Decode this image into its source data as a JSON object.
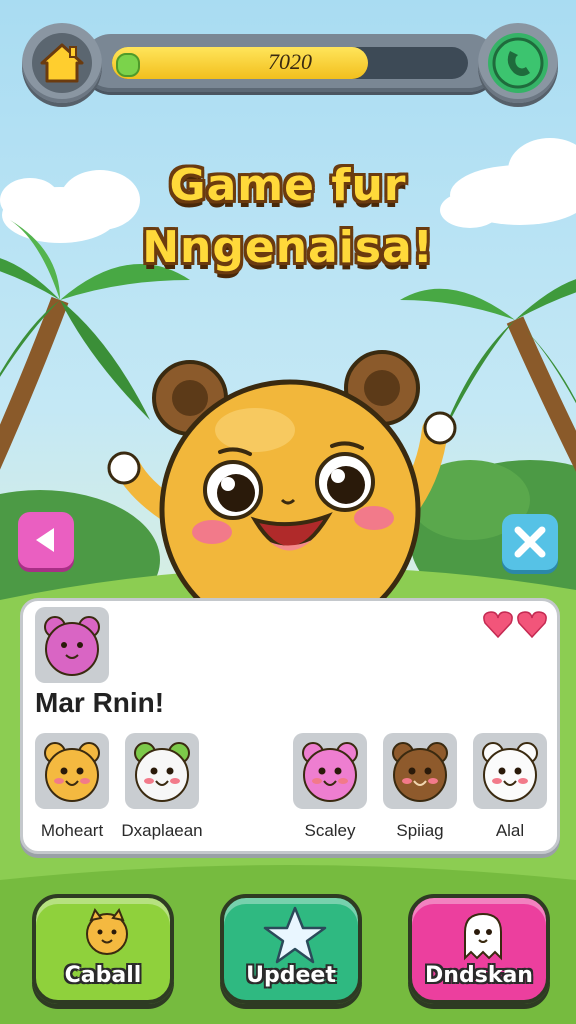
{
  "top_bar": {
    "score": "7020",
    "progress": 0.72,
    "home_icon": "home-icon",
    "phone_icon": "phone-icon"
  },
  "title": {
    "line1": "Game fur",
    "line2": "Nngenaisa!"
  },
  "side_buttons": {
    "left_icon": "back-arrow-icon",
    "right_icon": "close-x-icon"
  },
  "panel": {
    "heading": "Mar Rnin!",
    "lives": 2,
    "characters": [
      {
        "label": "Moheart",
        "color": "#f4b940",
        "icon": "yellow-bear-icon"
      },
      {
        "label": "Dxaplaean",
        "color": "#f7f7f7",
        "icon": "white-sheep-icon"
      },
      {
        "label": "Scaley",
        "color": "#ee7ed0",
        "icon": "pink-bear-icon"
      },
      {
        "label": "Spiiag",
        "color": "#8e5a2c",
        "icon": "brown-bear-icon"
      },
      {
        "label": "Alal",
        "color": "#fbfbfb",
        "icon": "white-bear-icon"
      }
    ]
  },
  "bottom_buttons": [
    {
      "label": "Caball",
      "color": "#8fd13c",
      "icon": "cat-face-icon"
    },
    {
      "label": "Updeet",
      "color": "#2fb981",
      "icon": "star-icon"
    },
    {
      "label": "Dndskan",
      "color": "#ec3f9e",
      "icon": "ghost-icon"
    }
  ],
  "colors": {
    "sky": "#bfe6f5",
    "grass": "#8ccd52",
    "title_fill": "#ffd93a",
    "title_outline": "#6b3b0f",
    "character_body": "#f2b73b"
  }
}
